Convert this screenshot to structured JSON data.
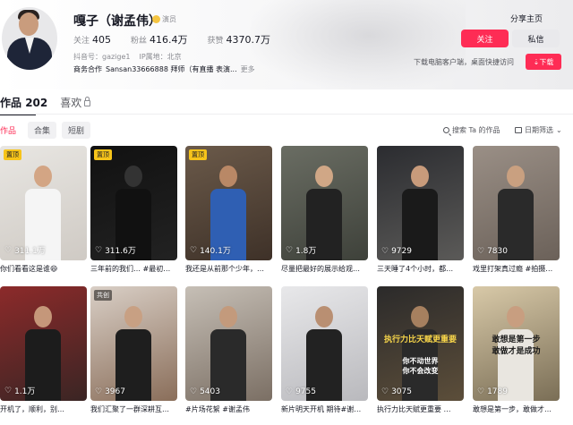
{
  "profile": {
    "name": "嘎子（谢孟伟）",
    "verified_label": "演员",
    "stats": [
      {
        "label": "关注",
        "value": "405"
      },
      {
        "label": "粉丝",
        "value": "416.4万"
      },
      {
        "label": "获赞",
        "value": "4370.7万"
      }
    ],
    "douyin_id": "抖音号：gazige1",
    "ip_location": "IP属地：北京",
    "business": "商务合作",
    "business_text": "Sansan33666888 拜师（有直播 表演...",
    "more_label": "更多"
  },
  "actions": {
    "share_label": "分享主页",
    "follow_label": "关注",
    "message_label": "私信",
    "download_tip": "下载电脑客户端，桌面快捷访问",
    "download_label": "下载"
  },
  "tabs": {
    "works_label": "作品",
    "works_count": "202",
    "likes_label": "喜欢"
  },
  "sub_tabs": [
    "作品",
    "合集",
    "短剧"
  ],
  "search_placeholder": "搜索 Ta 的作品",
  "filter_label": "日期筛选",
  "videos": [
    {
      "likes": "311.1万",
      "title": "你们看看这是谁😄",
      "tag": "置顶"
    },
    {
      "likes": "311.6万",
      "title": "三年前的我们… #最初…",
      "tag": "置顶"
    },
    {
      "likes": "140.1万",
      "title": "我还是从前那个少年，…",
      "tag": "置顶"
    },
    {
      "likes": "1.8万",
      "title": "尽量把最好的展示给观…",
      "tag": ""
    },
    {
      "likes": "9729",
      "title": "三天睡了4个小时，都…",
      "tag": ""
    },
    {
      "likes": "7830",
      "title": "戏里打架真过瘾 #拍摄…",
      "tag": ""
    },
    {
      "likes": "1.1万",
      "title": "开机了，顺利，别…",
      "tag": ""
    },
    {
      "likes": "3967",
      "title": "我们汇聚了一群深耕互…",
      "tag": "共创"
    },
    {
      "likes": "5403",
      "title": "#片场花絮 #谢孟伟",
      "tag": ""
    },
    {
      "likes": "9755",
      "title": "新片明天开机 期待#谢…",
      "tag": ""
    },
    {
      "likes": "3075",
      "title": "执行力比天赋更重要 …",
      "tag": "",
      "overlay": "执行力比天赋更重要",
      "overlay2": "你不动世界\n你不会改变"
    },
    {
      "likes": "1789",
      "title": "敢想是第一步，敢做才…",
      "tag": "",
      "overlay": "敢想是第一步\n敢做才是成功"
    }
  ],
  "colors": {
    "accent": "#fe2c55",
    "pin": "#f7c41a"
  }
}
